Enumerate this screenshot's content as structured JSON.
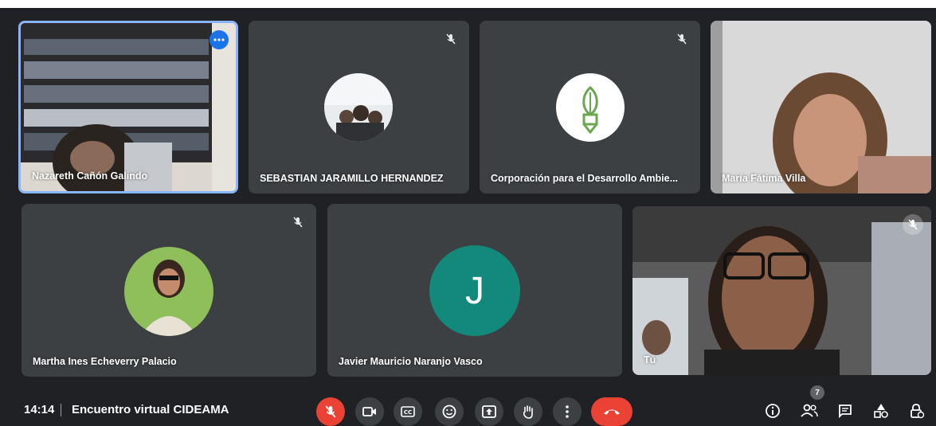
{
  "participants": [
    {
      "name": "Nazareth Cañón Galindo"
    },
    {
      "name": "SEBASTIAN JARAMILLO HERNANDEZ"
    },
    {
      "name": "Corporación para el Desarrollo Ambie..."
    },
    {
      "name": "María Fátima Villa"
    },
    {
      "name": "Martha Ines Echeverry Palacio"
    },
    {
      "name": "Javier Mauricio Naranjo Vasco",
      "initial": "J"
    },
    {
      "name": "Tú"
    }
  ],
  "bar": {
    "time": "14:14",
    "meeting_title": "Encuentro virtual CIDEAMA",
    "people_count": "7"
  },
  "colors": {
    "avatar_j": "#12897a",
    "end_call": "#ea4335",
    "active_border": "#8ab4f8"
  }
}
